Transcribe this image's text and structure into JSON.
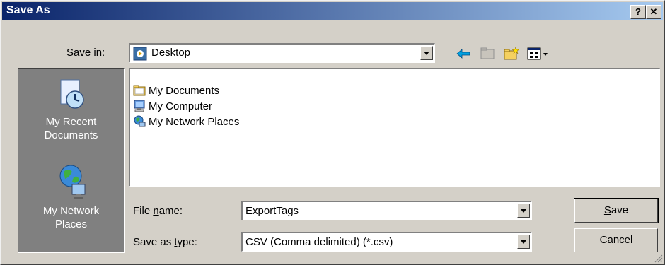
{
  "window": {
    "title": "Save As",
    "help_label": "?",
    "close_label": "✕"
  },
  "save_in": {
    "label_pre": "Save ",
    "label_u": "i",
    "label_post": "n:",
    "value": "Desktop"
  },
  "places": [
    {
      "line1": "My Recent",
      "line2": "Documents",
      "icon": "recent-documents-icon"
    },
    {
      "line1": "My Network",
      "line2": "Places",
      "icon": "network-places-icon"
    }
  ],
  "files": [
    {
      "name": "My Documents",
      "icon": "folder-icon"
    },
    {
      "name": "My Computer",
      "icon": "computer-icon"
    },
    {
      "name": "My Network Places",
      "icon": "network-icon"
    }
  ],
  "file_name": {
    "label_pre": "File ",
    "label_u": "n",
    "label_post": "ame:",
    "value": "ExportTags"
  },
  "save_type": {
    "label_pre": "Save as ",
    "label_u": "t",
    "label_post": "ype:",
    "value": "CSV (Comma delimited) (*.csv)"
  },
  "buttons": {
    "save_u": "S",
    "save_rest": "ave",
    "cancel": "Cancel"
  },
  "colors": {
    "titlebar_start": "#0a246a",
    "titlebar_end": "#a6caf0",
    "face": "#d4d0c8",
    "places_bg": "#808080"
  }
}
